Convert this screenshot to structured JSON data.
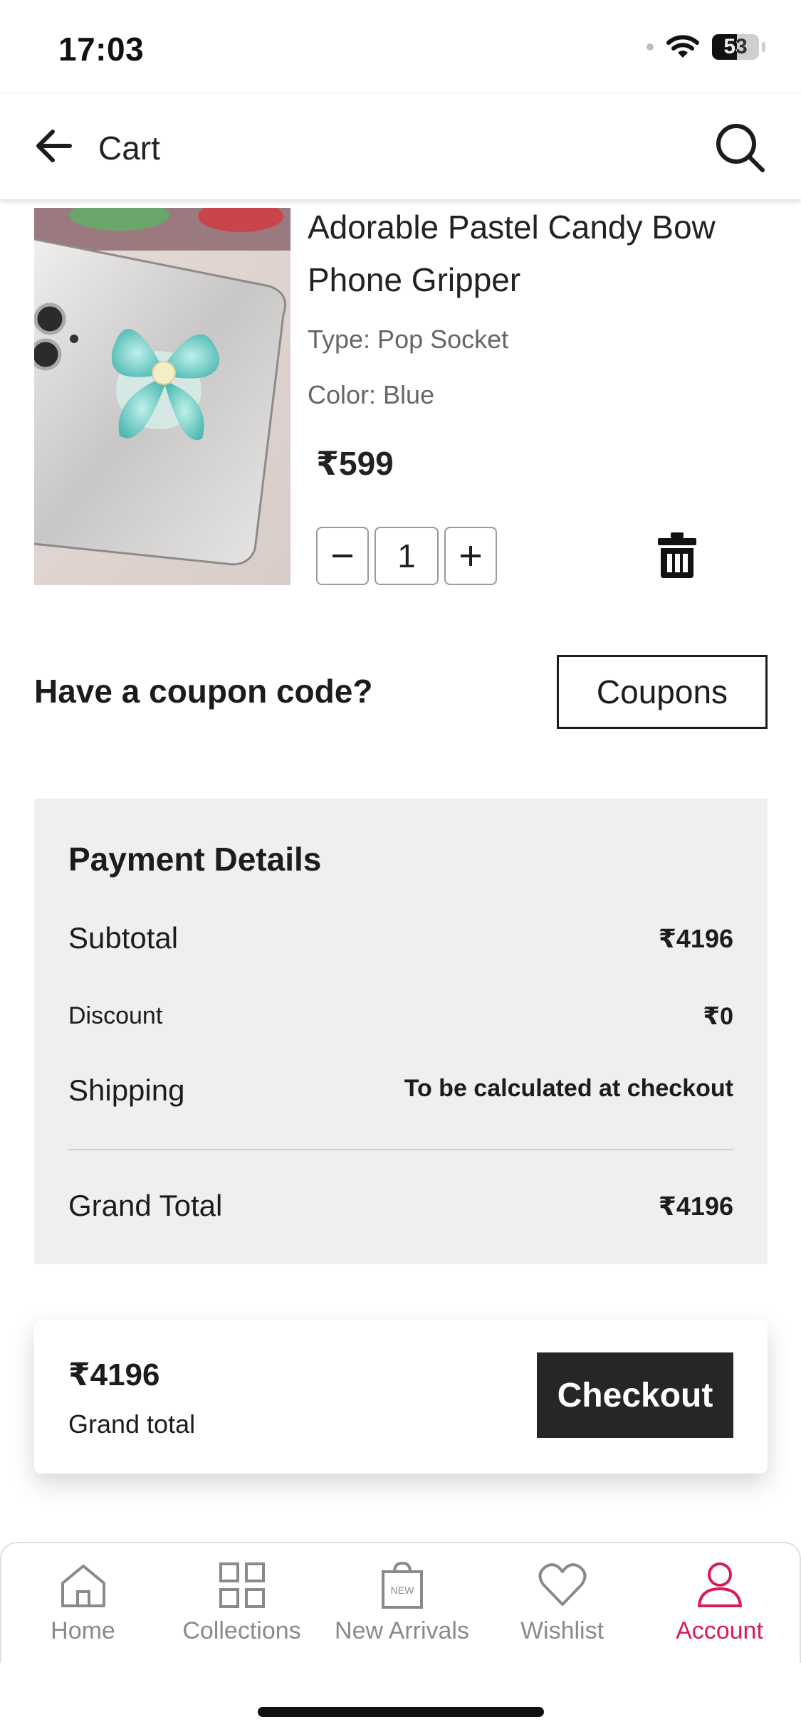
{
  "status": {
    "time": "17:03",
    "battery": "53",
    "battery_level": 0.53
  },
  "header": {
    "title": "Cart"
  },
  "product": {
    "title": "Adorable Pastel Candy Bow Phone Gripper",
    "type": "Type: Pop Socket",
    "color": "Color: Blue",
    "price": "₹599",
    "quantity": "1"
  },
  "coupon": {
    "label": "Have a coupon code?",
    "button": "Coupons"
  },
  "payment": {
    "title": "Payment Details",
    "subtotal_label": "Subtotal",
    "subtotal_value": "₹4196",
    "discount_label": "Discount",
    "discount_value": "₹0",
    "shipping_label": "Shipping",
    "shipping_value": "To be calculated at checkout",
    "grand_total_label": "Grand Total",
    "grand_total_value": "₹4196"
  },
  "checkout": {
    "amount": "₹4196",
    "label": "Grand total",
    "button": "Checkout"
  },
  "nav": {
    "items": [
      {
        "label": "Home",
        "icon": "home-icon"
      },
      {
        "label": "Collections",
        "icon": "grid-icon"
      },
      {
        "label": "New Arrivals",
        "icon": "shopping-bag-icon",
        "badge": "NEW"
      },
      {
        "label": "Wishlist",
        "icon": "heart-icon"
      },
      {
        "label": "Account",
        "icon": "user-icon",
        "active": true
      }
    ],
    "active_color": "#d81b60",
    "inactive_color": "#8a8a8a"
  }
}
